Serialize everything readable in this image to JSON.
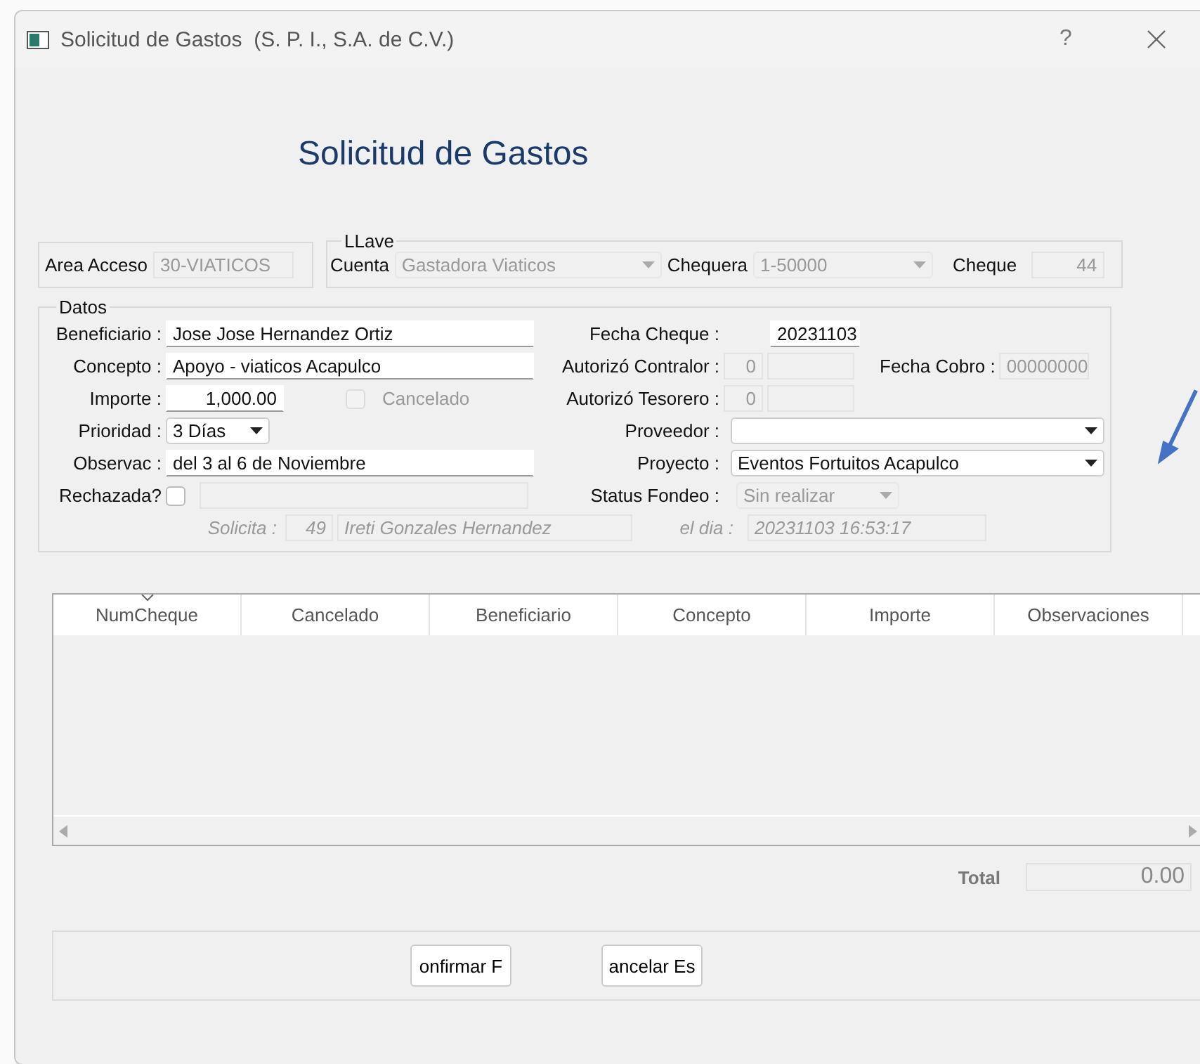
{
  "window": {
    "title": "Solicitud de Gastos  (S. P. I., S.A. de C.V.)",
    "help": "?"
  },
  "heading": "Solicitud de Gastos",
  "area_acceso": {
    "label": "Area Acceso",
    "value": "30-VIATICOS",
    "disabled": true
  },
  "llave": {
    "legend": "LLave",
    "cuenta": {
      "label": "Cuenta",
      "value": "Gastadora Viaticos",
      "disabled": true
    },
    "chequera": {
      "label": "Chequera",
      "value": "1-50000",
      "disabled": true
    },
    "cheque": {
      "label": "Cheque",
      "value": "44",
      "disabled": true
    }
  },
  "datos": {
    "legend": "Datos",
    "beneficiario": {
      "label": "Beneficiario :",
      "value": "Jose Jose Hernandez Ortiz",
      "disabled": false
    },
    "concepto": {
      "label": "Concepto :",
      "value": "Apoyo - viaticos Acapulco",
      "disabled": false
    },
    "importe": {
      "label": "Importe :",
      "value": "1,000.00",
      "disabled": false
    },
    "cancelado": {
      "label": "Cancelado",
      "checked": false,
      "disabled": true
    },
    "prioridad": {
      "label": "Prioridad :",
      "value": "3 Días",
      "disabled": false
    },
    "observac": {
      "label": "Observac :",
      "value": "del 3 al 6 de Noviembre",
      "disabled": false
    },
    "rechazada": {
      "label": "Rechazada?",
      "checked": false,
      "disabled": false
    },
    "fecha_cheque": {
      "label": "Fecha Cheque :",
      "value": "20231103",
      "disabled": false
    },
    "autorizo_contralor": {
      "label": "Autorizó Contralor :",
      "value": "0",
      "disabled": true
    },
    "fecha_cobro": {
      "label": "Fecha Cobro :",
      "value": "00000000",
      "disabled": true
    },
    "autorizo_tesorero": {
      "label": "Autorizó Tesorero :",
      "value": "0",
      "disabled": true
    },
    "proveedor": {
      "label": "Proveedor :",
      "disabled": false
    },
    "proyecto": {
      "label": "Proyecto :",
      "value": "Eventos Fortuitos Acapulco",
      "disabled": false
    },
    "status_fondeo": {
      "label": "Status Fondeo :",
      "value": "Sin realizar",
      "disabled": true
    },
    "solicita": {
      "label": "Solicita :",
      "id": "49",
      "name": "Ireti Gonzales Hernandez"
    },
    "el_dia": {
      "label": "el dia :",
      "value": "20231103 16:53:17"
    }
  },
  "table": {
    "columns": [
      {
        "label": "NumCheque",
        "sorted": true
      },
      {
        "label": "Cancelado",
        "sorted": false
      },
      {
        "label": "Beneficiario",
        "sorted": false
      },
      {
        "label": "Concepto",
        "sorted": false
      },
      {
        "label": "Importe",
        "sorted": false
      },
      {
        "label": "Observaciones",
        "sorted": false
      }
    ]
  },
  "total": {
    "label": "Total",
    "value": "0.00"
  },
  "buttons": [
    "onfirmar F",
    "ancelar Es"
  ]
}
